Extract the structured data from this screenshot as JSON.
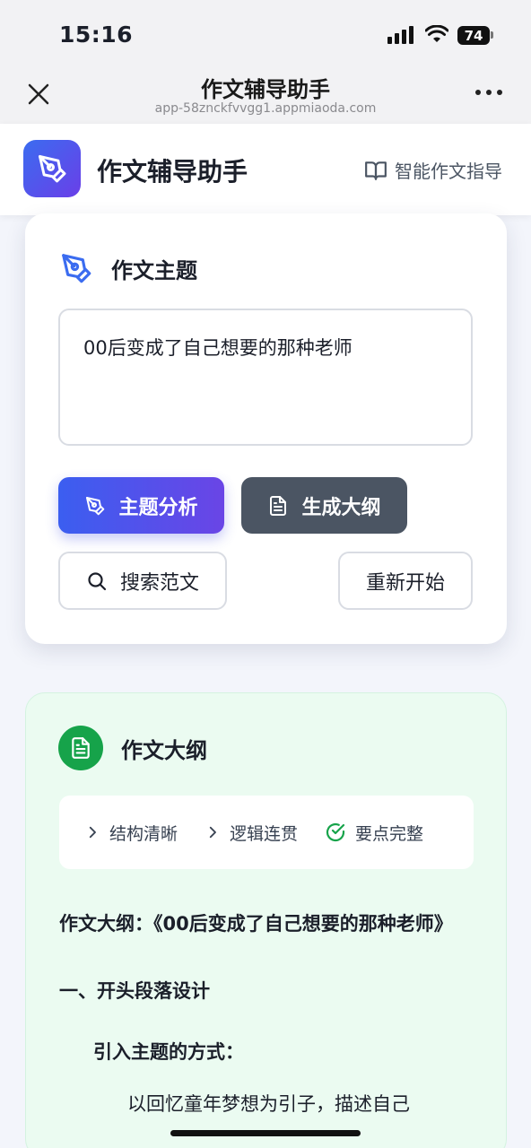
{
  "status": {
    "time": "15:16",
    "battery": "74"
  },
  "browser": {
    "title": "作文辅导助手",
    "url": "app-58znckfvvgg1.appmiaoda.com"
  },
  "app": {
    "title": "作文辅导助手",
    "guide_link": "智能作文指导"
  },
  "topic_card": {
    "title": "作文主题",
    "input_value": "00后变成了自己想要的那种老师",
    "analyze_label": "主题分析",
    "outline_label": "生成大纲",
    "search_label": "搜索范文",
    "restart_label": "重新开始"
  },
  "outline_card": {
    "title": "作文大纲",
    "features": [
      "结构清晰",
      "逻辑连贯",
      "要点完整"
    ],
    "heading": "作文大纲：《00后变成了自己想要的那种老师》",
    "section1": "一、开头段落设计",
    "subsection1": "引入主题的方式：",
    "item1": "以回忆童年梦想为引子，描述自己"
  },
  "colors": {
    "primary": "#3b5ef0",
    "secondary": "#4b5563",
    "success": "#16a34a"
  }
}
